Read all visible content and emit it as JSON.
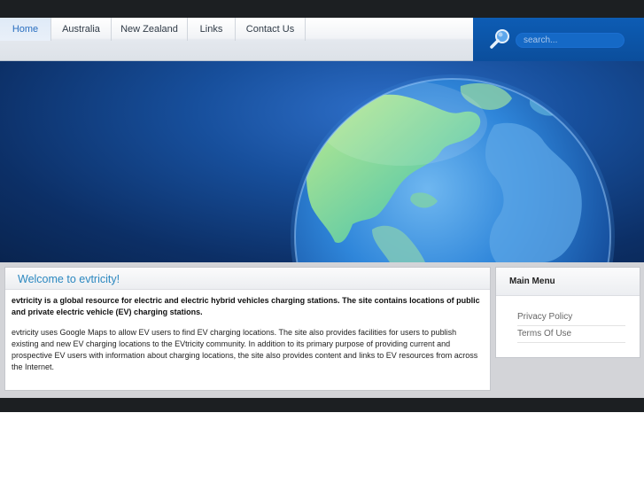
{
  "nav": {
    "items": [
      {
        "label": "Home",
        "active": true
      },
      {
        "label": "Australia",
        "active": false
      },
      {
        "label": "New Zealand",
        "active": false
      },
      {
        "label": "Links",
        "active": false
      },
      {
        "label": "Contact Us",
        "active": false
      }
    ]
  },
  "search": {
    "placeholder": "search...",
    "icon": "magnifier-icon"
  },
  "hero": {
    "image": "globe-icon"
  },
  "main": {
    "title": "Welcome to evtricity!",
    "intro_bold": "evtricity is a global resource for electric and electric hybrid vehicles charging stations. The site contains locations of public and private electric vehicle (EV) charging stations.",
    "intro_text": "evtricity uses Google Maps to allow EV users to find EV charging locations. The site also provides facilities for users to publish existing and new EV charging locations to the EVtricity community. In addition to its primary purpose of providing current and prospective EV users with information about charging locations, the site also provides content and links to EV resources from across the Internet."
  },
  "sidebar": {
    "title": "Main Menu",
    "items": [
      {
        "label": "Privacy Policy"
      },
      {
        "label": "Terms Of Use"
      }
    ]
  },
  "colors": {
    "accent": "#2c88c0",
    "header_dark": "#1c1f22",
    "search_bg": "#0d5cb4"
  }
}
